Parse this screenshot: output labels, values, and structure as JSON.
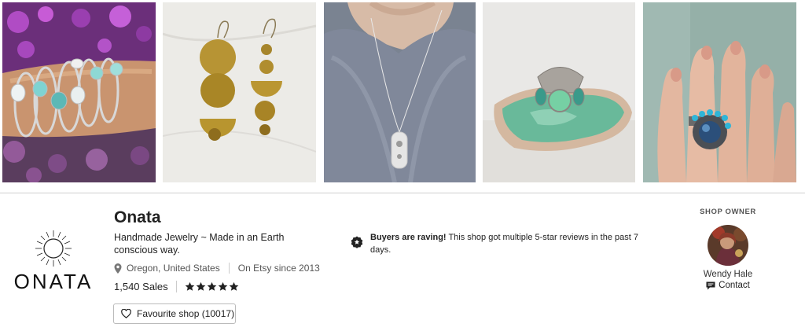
{
  "gallery": {
    "images": [
      {
        "name": "bracelets-photo"
      },
      {
        "name": "earrings-photo"
      },
      {
        "name": "necklace-photo"
      },
      {
        "name": "ring-on-stone-photo"
      },
      {
        "name": "ring-on-hand-photo"
      }
    ]
  },
  "shop": {
    "logo_text": "ONATA",
    "name": "Onata",
    "title": "Handmade Jewelry ~ Made in an Earth conscious way.",
    "location": "Oregon, United States",
    "since": "On Etsy since 2013",
    "sales": "1,540 Sales",
    "rating_stars": 5,
    "favourite_label": "Favourite shop (10017)"
  },
  "raving": {
    "bold": "Buyers are raving!",
    "text": " This shop got multiple 5-star reviews in the past 7 days."
  },
  "owner": {
    "heading": "SHOP OWNER",
    "name": "Wendy Hale",
    "contact_label": "Contact"
  },
  "icons": {
    "location": "map-pin-icon",
    "star": "star-icon",
    "favourite": "heart-icon",
    "raving": "review-badge-icon",
    "contact": "chat-icon"
  },
  "colors": {
    "text": "#222222",
    "muted": "#555555",
    "border": "#cfcfcf"
  }
}
